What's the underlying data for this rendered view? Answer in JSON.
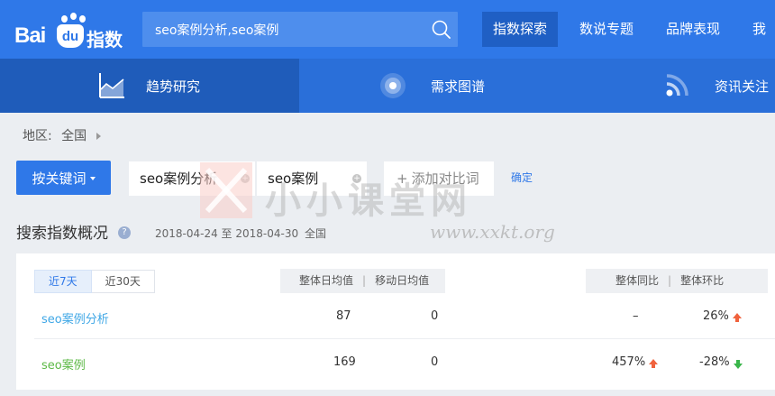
{
  "header": {
    "logo": {
      "latin": "Bai",
      "badge": "du",
      "chinese": "指数"
    },
    "search": {
      "value": "seo案例分析,seo案例"
    },
    "nav": [
      {
        "label": "指数探索",
        "active": true
      },
      {
        "label": "数说专题",
        "active": false
      },
      {
        "label": "品牌表现",
        "active": false
      },
      {
        "label": "我",
        "active": false
      }
    ]
  },
  "tabs": [
    {
      "label": "趋势研究",
      "icon": "area-chart-icon",
      "active": true
    },
    {
      "label": "需求图谱",
      "icon": "radar-icon",
      "active": false
    },
    {
      "label": "资讯关注",
      "icon": "rss-icon",
      "active": false
    }
  ],
  "filters": {
    "region_label": "地区:",
    "region_value": "全国",
    "keyword_button": "按关键词",
    "keywords": [
      "seo案例分析",
      "seo案例"
    ],
    "add_compare": "添加对比词",
    "confirm": "确定"
  },
  "watermark": {
    "main": "小小课堂网",
    "url": "www.xxkt.org"
  },
  "overview": {
    "title": "搜索指数概况",
    "date_range": "2018-04-24 至 2018-04-30",
    "region": "全国",
    "ranges": [
      "近7天",
      "近30天"
    ],
    "headers": {
      "daily_avg": "整体日均值",
      "mobile_avg": "移动日均值",
      "yoy": "整体同比",
      "mom": "整体环比"
    },
    "rows": [
      {
        "keyword": "seo案例分析",
        "daily_avg": "87",
        "mobile_avg": "0",
        "yoy": "–",
        "yoy_dir": "",
        "mom": "26%",
        "mom_dir": "up"
      },
      {
        "keyword": "seo案例",
        "daily_avg": "169",
        "mobile_avg": "0",
        "yoy": "457%",
        "yoy_dir": "up",
        "mom": "-28%",
        "mom_dir": "down"
      }
    ]
  },
  "colors": {
    "header_bg": "#2f78e8",
    "tabbar_bg": "#2a6fd9",
    "keyword1": "#3fa7e6",
    "keyword2": "#5cb946",
    "up": "#f0623d",
    "down": "#39b54a"
  }
}
